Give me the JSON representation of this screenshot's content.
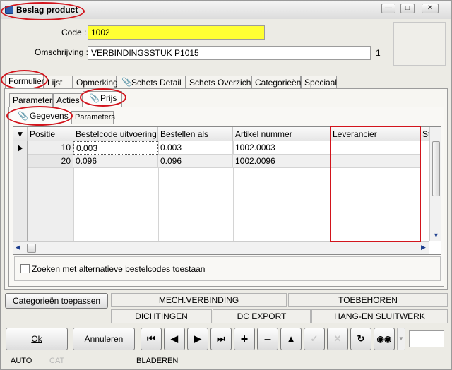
{
  "window": {
    "title": "Beslag product",
    "controls": [
      "—",
      "□",
      "✕"
    ]
  },
  "form": {
    "code_label": "Code :",
    "code_value": "1002",
    "description_label": "Omschrijving :",
    "description_value": "VERBINDINGSSTUK P1015",
    "description_suffix": "1"
  },
  "main_tabs": [
    "Formulier",
    "Lijst",
    "Opmerking",
    "Schets Detail",
    "Schets Overzicht",
    "Categorieën",
    "Speciaal"
  ],
  "sub_tabs": [
    "Parameters",
    "Acties",
    "Prijs"
  ],
  "inner_tabs": [
    "Gegevens",
    "Parameters"
  ],
  "grid": {
    "headers": [
      "Positie",
      "Bestelcode uitvoering",
      "Bestellen als",
      "Artikel nummer",
      "Leverancier",
      "St"
    ],
    "rows": [
      {
        "positie": "10",
        "bestelcode": "0.003",
        "bestellen_als": "0.003",
        "artikel": "1002.0003",
        "leverancier": ""
      },
      {
        "positie": "20",
        "bestelcode": "0.096",
        "bestellen_als": "0.096",
        "artikel": "1002.0096",
        "leverancier": ""
      }
    ]
  },
  "checkbox_label": "Zoeken met alternatieve bestelcodes toestaan",
  "categories": {
    "apply_button": "Categorieën toepassen",
    "items": [
      "MECH.VERBINDING",
      "TOEBEHOREN",
      "DICHTINGEN",
      "DC EXPORT",
      "HANG-EN SLUITWERK"
    ]
  },
  "buttons": {
    "ok": "Ok",
    "cancel": "Annuleren"
  },
  "nav_icons": [
    "first-icon",
    "prev-icon",
    "next-icon",
    "last-icon",
    "add-icon",
    "remove-icon",
    "up-icon",
    "confirm-icon",
    "cancel-icon",
    "refresh-icon",
    "binoculars-icon"
  ],
  "status": {
    "mode": "AUTO",
    "cat": "CAT",
    "state": "BLADEREN"
  },
  "highlight_color": "#d2141c",
  "code_field_color": "#ffff33"
}
